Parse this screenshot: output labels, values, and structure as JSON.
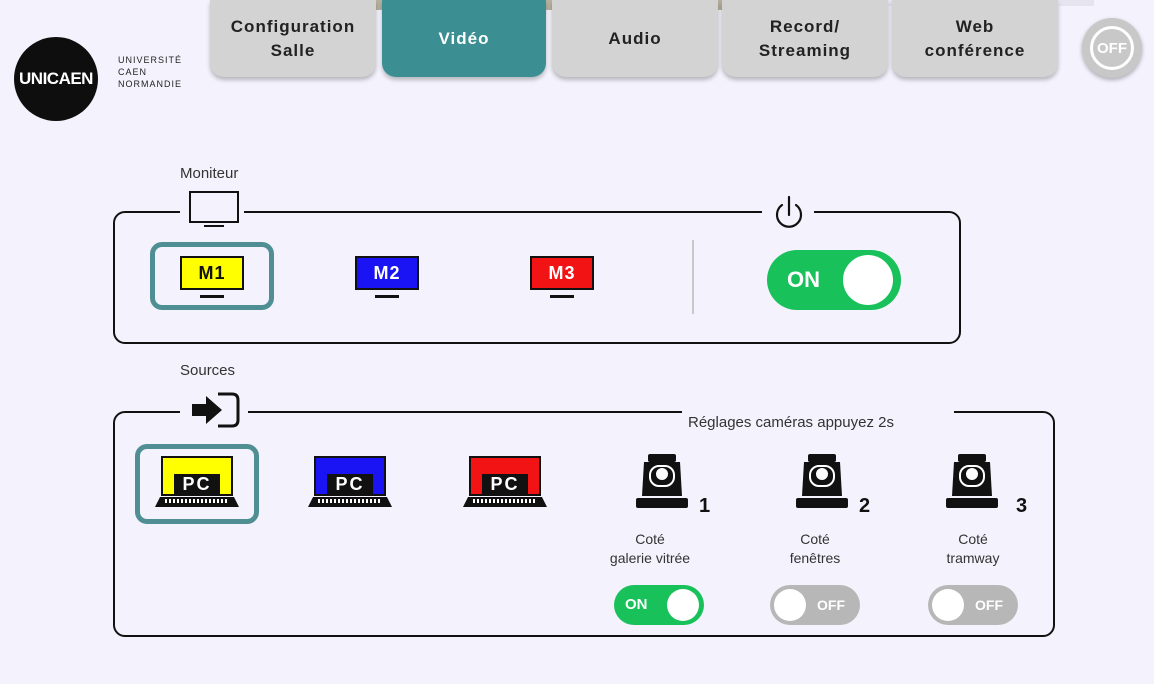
{
  "logo": {
    "mark": "UNICAEN",
    "lines": [
      "UNIVERSITÉ",
      "CAEN",
      "NORMANDIE"
    ]
  },
  "tabs": [
    {
      "line1": "Configuration",
      "line2": "Salle",
      "active": false
    },
    {
      "line1": "Vidéo",
      "line2": "",
      "active": true
    },
    {
      "line1": "Audio",
      "line2": "",
      "active": false
    },
    {
      "line1": "Record/",
      "line2": "Streaming",
      "active": false
    },
    {
      "line1": "Web",
      "line2": "conférence",
      "active": false
    }
  ],
  "power_off_button": "OFF",
  "monitors": {
    "label": "Moniteur",
    "items": [
      {
        "label": "M1",
        "color": "#ffff00",
        "text_color": "#111111",
        "selected": true
      },
      {
        "label": "M2",
        "color": "#1a14f5",
        "text_color": "#ffffff",
        "selected": false
      },
      {
        "label": "M3",
        "color": "#f21414",
        "text_color": "#ffffff",
        "selected": false
      }
    ],
    "power_toggle": "ON"
  },
  "sources": {
    "label": "Sources",
    "camera_hint": "Réglages caméras appuyez 2s",
    "laptops": [
      {
        "label": "PC",
        "color": "#ffff00",
        "selected": true
      },
      {
        "label": "PC",
        "color": "#1a14f5",
        "selected": false
      },
      {
        "label": "PC",
        "color": "#f21414",
        "selected": false
      }
    ],
    "cameras": [
      {
        "number": "1",
        "line1": "Coté",
        "line2": "galerie vitrée",
        "toggle": "ON"
      },
      {
        "number": "2",
        "line1": "Coté",
        "line2": "fenêtres",
        "toggle": "OFF"
      },
      {
        "number": "3",
        "line1": "Coté",
        "line2": "tramway",
        "toggle": "OFF"
      }
    ]
  },
  "colors": {
    "accent": "#3b8e92",
    "selection": "#4f8f94",
    "toggle_on": "#19c15a",
    "toggle_off": "#b7b7b7"
  }
}
